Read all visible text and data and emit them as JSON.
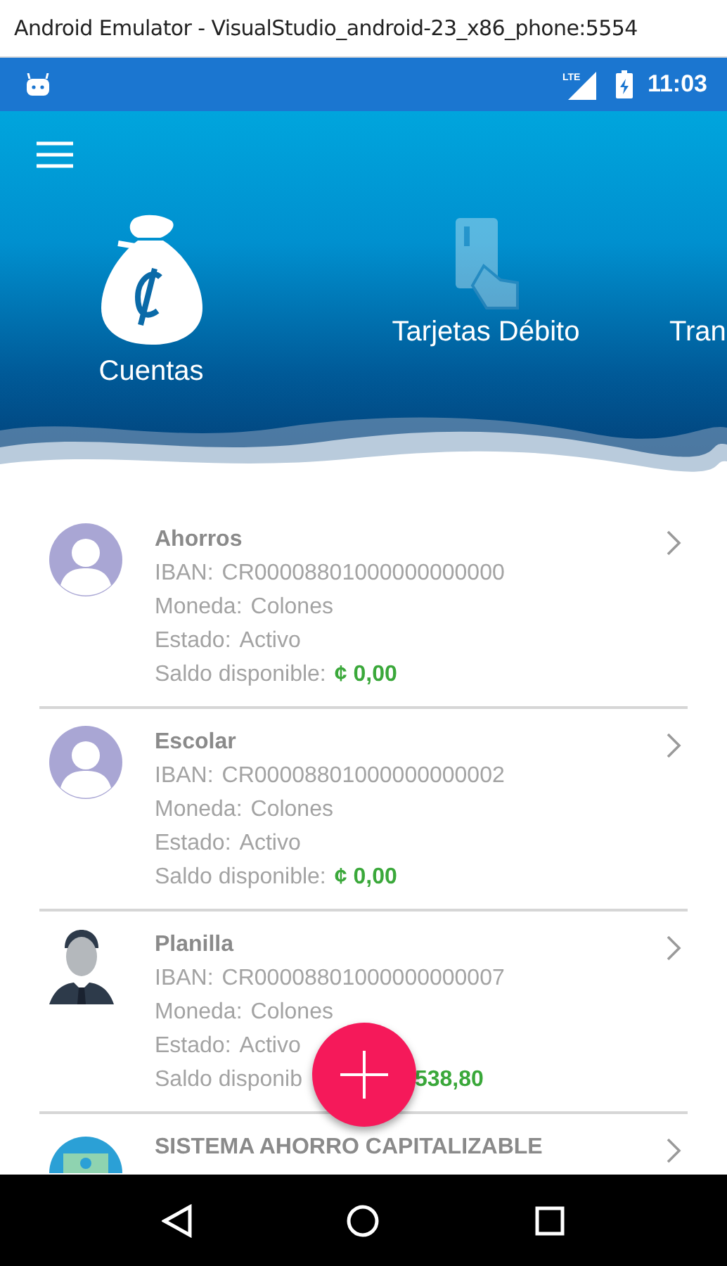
{
  "window": {
    "title": "Android Emulator - VisualStudio_android-23_x86_phone:5554"
  },
  "status_bar": {
    "time": "11:03",
    "network": "LTE"
  },
  "tabs": [
    {
      "label": "Cuentas",
      "selected": true,
      "kind": "bag"
    },
    {
      "label": "Tarjetas Débito",
      "selected": false,
      "kind": "card"
    },
    {
      "label": "Tran",
      "selected": false,
      "kind": "none"
    }
  ],
  "accounts": [
    {
      "name": "Ahorros",
      "iban_label": "IBAN:",
      "iban": "CR00008801000000000000",
      "currency_label": "Moneda:",
      "currency": "Colones",
      "status_label": "Estado:",
      "status": "Activo",
      "balance_label": "Saldo disponible:",
      "balance": "¢ 0,00",
      "kind": "silhouette"
    },
    {
      "name": "Escolar",
      "iban_label": "IBAN:",
      "iban": "CR00008801000000000002",
      "currency_label": "Moneda:",
      "currency": "Colones",
      "status_label": "Estado:",
      "status": "Activo",
      "balance_label": "Saldo disponible:",
      "balance": "¢ 0,00",
      "kind": "silhouette"
    },
    {
      "name": "Planilla",
      "iban_label": "IBAN:",
      "iban": "CR00008801000000000007",
      "currency_label": "Moneda:",
      "currency": "Colones",
      "status_label": "Estado:",
      "status": "Activo",
      "balance_label": "Saldo disponib",
      "balance": "538,80",
      "kind": "businessman"
    },
    {
      "name": "SISTEMA AHORRO CAPITALIZABLE",
      "kind": "banknote"
    }
  ]
}
